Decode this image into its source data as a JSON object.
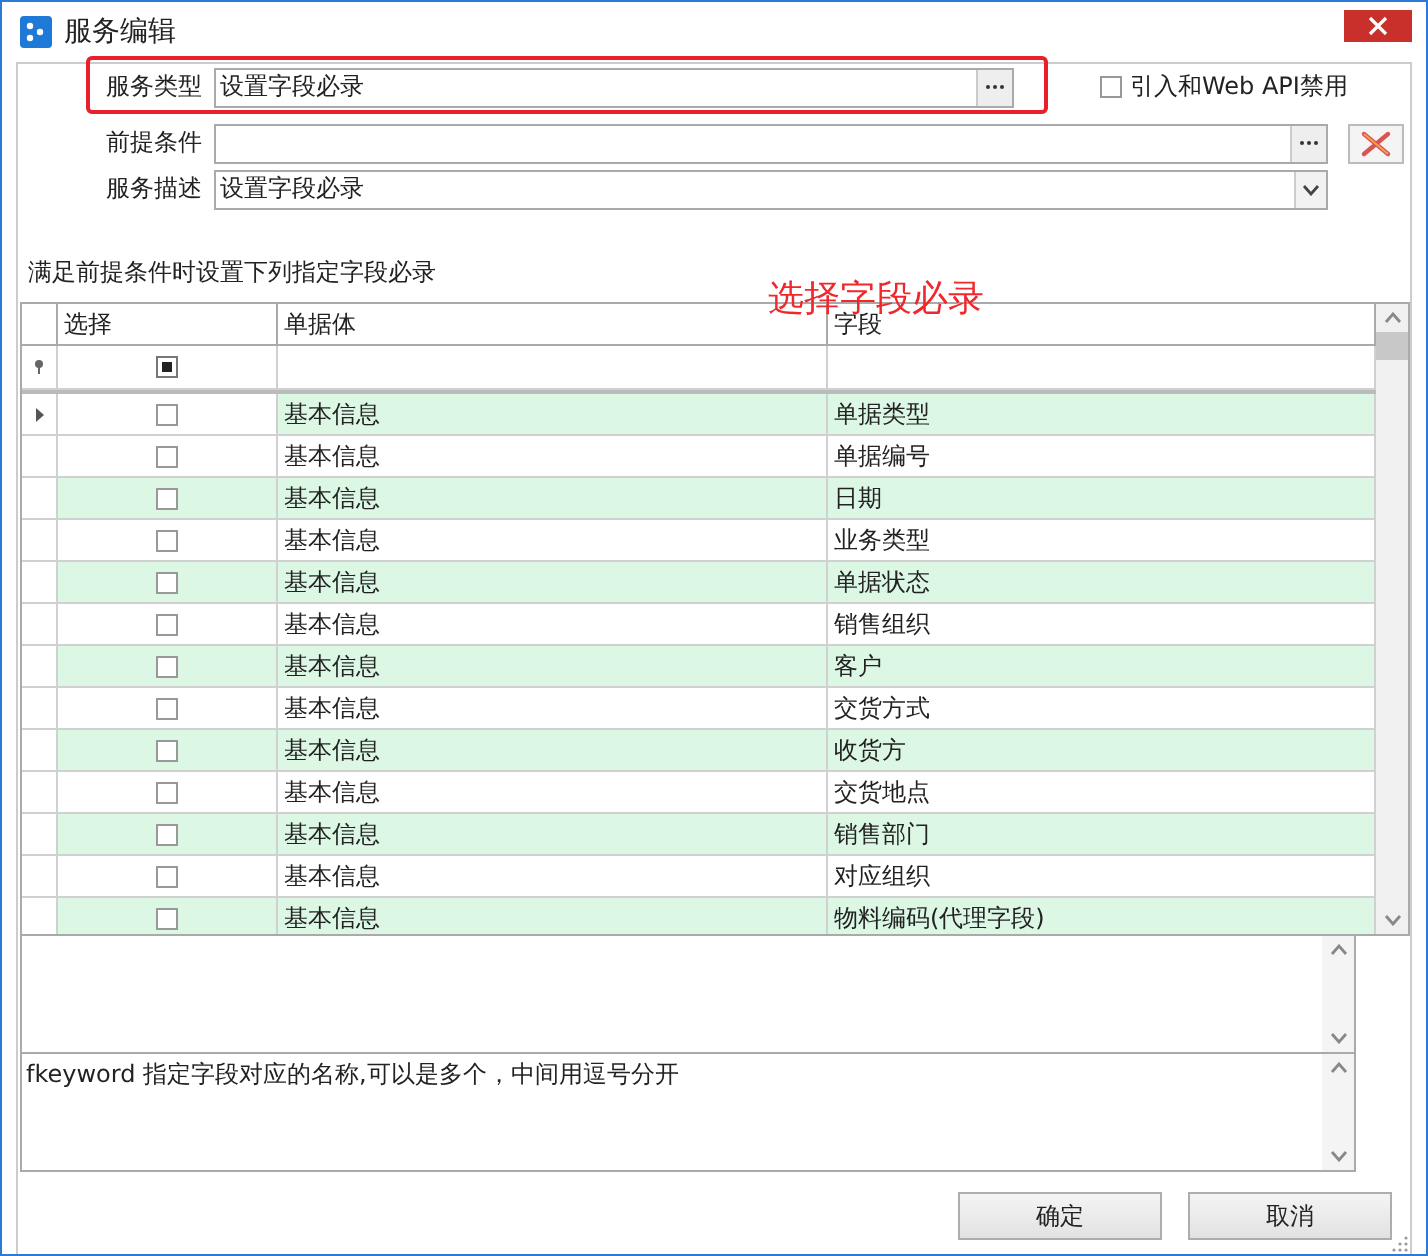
{
  "window": {
    "title": "服务编辑"
  },
  "form": {
    "service_type": {
      "label": "服务类型",
      "value": "设置字段必录"
    },
    "condition": {
      "label": "前提条件"
    },
    "description": {
      "label": "服务描述",
      "value": "设置字段必录"
    },
    "web_api_disable": {
      "label": "引入和Web API禁用",
      "checked": false
    }
  },
  "section_label": "满足前提条件时设置下列指定字段必录",
  "annotation": "选择字段必录",
  "grid": {
    "columns": [
      "选择",
      "单据体",
      "字段"
    ],
    "filter_select_all_partial": true,
    "rows": [
      {
        "checked": false,
        "current": true,
        "entity": "基本信息",
        "field": "单据类型"
      },
      {
        "checked": false,
        "current": false,
        "entity": "基本信息",
        "field": "单据编号"
      },
      {
        "checked": false,
        "current": false,
        "entity": "基本信息",
        "field": "日期"
      },
      {
        "checked": false,
        "current": false,
        "entity": "基本信息",
        "field": "业务类型"
      },
      {
        "checked": false,
        "current": false,
        "entity": "基本信息",
        "field": "单据状态"
      },
      {
        "checked": false,
        "current": false,
        "entity": "基本信息",
        "field": "销售组织"
      },
      {
        "checked": false,
        "current": false,
        "entity": "基本信息",
        "field": "客户"
      },
      {
        "checked": false,
        "current": false,
        "entity": "基本信息",
        "field": "交货方式"
      },
      {
        "checked": false,
        "current": false,
        "entity": "基本信息",
        "field": "收货方"
      },
      {
        "checked": false,
        "current": false,
        "entity": "基本信息",
        "field": "交货地点"
      },
      {
        "checked": false,
        "current": false,
        "entity": "基本信息",
        "field": "销售部门"
      },
      {
        "checked": false,
        "current": false,
        "entity": "基本信息",
        "field": "对应组织"
      },
      {
        "checked": false,
        "current": false,
        "entity": "基本信息",
        "field": "物料编码(代理字段)"
      }
    ]
  },
  "hint_text": "fkeyword 指定字段对应的名称,可以是多个，中间用逗号分开",
  "buttons": [
    "确定",
    "取消"
  ]
}
